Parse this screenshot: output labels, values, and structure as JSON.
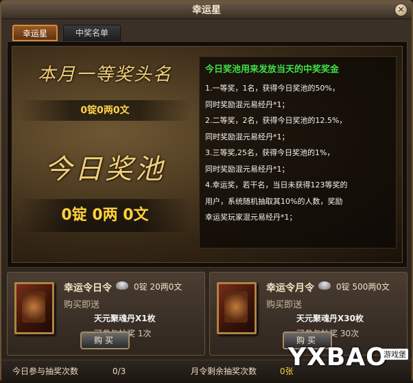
{
  "window": {
    "title": "幸运星",
    "close_icon": "close-icon"
  },
  "tabs": [
    {
      "label": "幸运星",
      "active": true
    },
    {
      "label": "中奖名单",
      "active": false
    }
  ],
  "left": {
    "month_title": "本月一等奖头名",
    "month_value": "0锭0两0文",
    "pool_title": "今日奖池",
    "pool_value": "0锭 0两 0文"
  },
  "rules": {
    "title": "今日奖池用来发放当天的中奖奖金",
    "lines": [
      "1.一等奖，1名，获得今日奖池的50%，",
      "同时奖励混元易经丹*1；",
      "2.二等奖，2名，获得今日奖池的12.5%，",
      "同时奖励混元易经丹*1；",
      "3.三等奖,25名，获得今日奖池的1%，",
      "同时奖励混元易经丹*1；",
      "4.幸运奖，若干名，当日未获得123等奖的",
      "用户，系统随机抽取其10%的人数，奖励",
      "幸运奖玩家混元易经丹*1；"
    ]
  },
  "cards": [
    {
      "name": "幸运令日令",
      "price": "0锭 20两0文",
      "gift": "购买即送",
      "item": "天元聚魂丹X1枚",
      "draw": "可参与抽奖 1次",
      "buy": "购买"
    },
    {
      "name": "幸运令月令",
      "price": "0锭 500两0文",
      "gift": "购买即送",
      "item": "天元聚魂丹X30枚",
      "draw": "可参与抽奖 30次",
      "buy": "购买"
    }
  ],
  "footer": {
    "today_label": "今日参与抽奖次数",
    "today_count": "0/3",
    "month_label": "月令剩余抽奖次数",
    "month_count": "0张",
    "watermark": "YXBAO",
    "watermark_tag": "游戏堡"
  },
  "colors": {
    "accent_gold": "#ffd34a",
    "rules_title_green": "#3fe04a",
    "tab_active": "#9a5a22"
  }
}
